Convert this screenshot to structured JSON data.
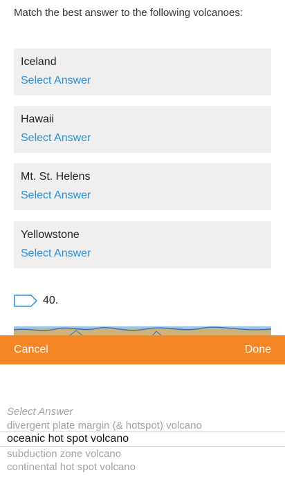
{
  "prompt": "Match the best answer to the following volcanoes:",
  "items": [
    {
      "label": "Iceland",
      "answer": "Select Answer"
    },
    {
      "label": "Hawaii",
      "answer": "Select Answer"
    },
    {
      "label": "Mt. St. Helens",
      "answer": "Select Answer"
    },
    {
      "label": "Yellowstone",
      "answer": "Select Answer"
    }
  ],
  "question_number": "40.",
  "toolbar": {
    "cancel_label": "Cancel",
    "done_label": "Done",
    "color": "#f58626"
  },
  "picker": {
    "options": [
      "Select Answer",
      "divergent plate margin (& hotspot) volcano",
      "oceanic hot spot volcano",
      "subduction zone volcano",
      "continental hot spot volcano"
    ],
    "selected": "oceanic hot spot volcano"
  },
  "colors": {
    "link": "#2a8fd6",
    "card_bg": "#efefef",
    "accent": "#f58626"
  },
  "icons": {
    "flag": "question-flag-icon"
  }
}
